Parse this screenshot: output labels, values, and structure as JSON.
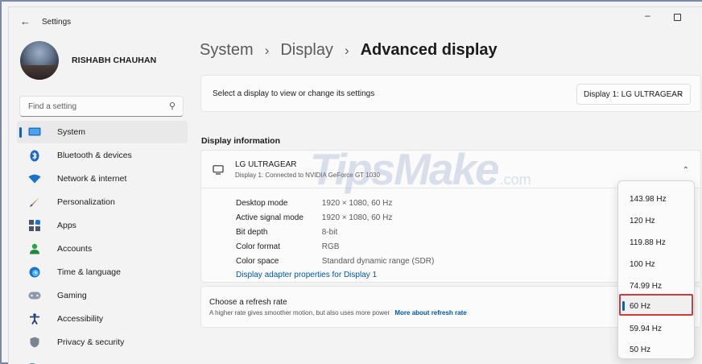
{
  "window": {
    "title": "Settings"
  },
  "profile": {
    "name": "RISHABH CHAUHAN"
  },
  "search": {
    "placeholder": "Find a setting"
  },
  "sidebar": {
    "items": [
      {
        "label": "System",
        "icon": "monitor-icon",
        "active": true
      },
      {
        "label": "Bluetooth & devices",
        "icon": "bluetooth-icon"
      },
      {
        "label": "Network & internet",
        "icon": "wifi-icon"
      },
      {
        "label": "Personalization",
        "icon": "brush-icon"
      },
      {
        "label": "Apps",
        "icon": "apps-icon"
      },
      {
        "label": "Accounts",
        "icon": "person-icon"
      },
      {
        "label": "Time & language",
        "icon": "globe-clock-icon"
      },
      {
        "label": "Gaming",
        "icon": "gamepad-icon"
      },
      {
        "label": "Accessibility",
        "icon": "accessibility-icon"
      },
      {
        "label": "Privacy & security",
        "icon": "shield-icon"
      }
    ]
  },
  "breadcrumb": {
    "level1": "System",
    "level2": "Display",
    "current": "Advanced display",
    "separator": "›"
  },
  "display_select": {
    "label": "Select a display to view or change its settings",
    "value": "Display 1: LG ULTRAGEAR"
  },
  "display_info": {
    "section_title": "Display information",
    "monitor_name": "LG ULTRAGEAR",
    "monitor_sub": "Display 1: Connected to NVIDIA GeForce GT 1030",
    "specs": [
      {
        "label": "Desktop mode",
        "value": "1920 × 1080, 60 Hz"
      },
      {
        "label": "Active signal mode",
        "value": "1920 × 1080, 60 Hz"
      },
      {
        "label": "Bit depth",
        "value": "8-bit"
      },
      {
        "label": "Color format",
        "value": "RGB"
      },
      {
        "label": "Color space",
        "value": "Standard dynamic range (SDR)"
      }
    ],
    "adapter_link": "Display adapter properties for Display 1"
  },
  "refresh": {
    "title": "Choose a refresh rate",
    "subtitle": "A higher rate gives smoother motion, but also uses more power",
    "link": "More about refresh rate",
    "options": [
      "143.98 Hz",
      "120 Hz",
      "119.88 Hz",
      "100 Hz",
      "74.99 Hz",
      "60 Hz",
      "59.94 Hz",
      "50 Hz"
    ],
    "selected": "60 Hz"
  },
  "watermark": {
    "main": "TipsMake",
    "suffix": ".com"
  },
  "colors": {
    "accent": "#0067c0",
    "highlight": "#d03a3a",
    "link": "#0058a8"
  }
}
